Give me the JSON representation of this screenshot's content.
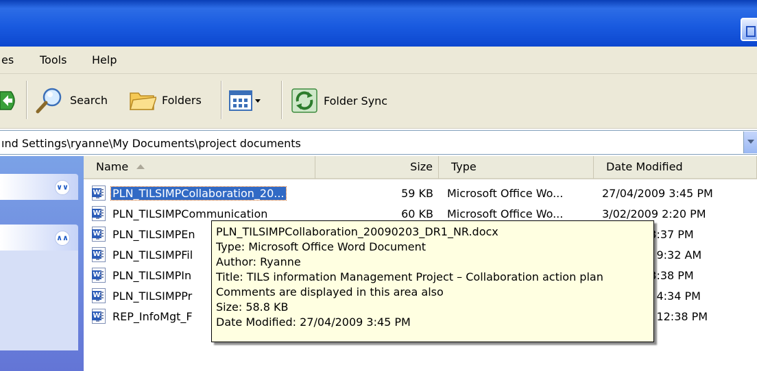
{
  "menu": {
    "items": [
      "es",
      "Tools",
      "Help"
    ]
  },
  "toolbar": {
    "search_label": "Search",
    "folders_label": "Folders",
    "folder_sync_label": "Folder Sync"
  },
  "address": {
    "path": "ınd Settings\\ryanne\\My Documents\\project documents"
  },
  "columns": {
    "name": "Name",
    "size": "Size",
    "type": "Type",
    "date": "Date Modified"
  },
  "files": [
    {
      "name": "PLN_TILSIMPCollaboration_20...",
      "size": "59 KB",
      "type": "Microsoft Office Wo...",
      "date": "27/04/2009 3:45 PM",
      "selected": true
    },
    {
      "name": "PLN_TILSIMPCommunication",
      "size": "60 KB",
      "type": "Microsoft Office Wo...",
      "date": "3/02/2009 2:20 PM"
    },
    {
      "name": "PLN_TILSIMPEn",
      "size": "",
      "type": "",
      "date": "9 3:37 PM"
    },
    {
      "name": "PLN_TILSIMPFil",
      "size": "",
      "type": "",
      "date": "09 9:32 AM"
    },
    {
      "name": "PLN_TILSIMPIn",
      "size": "",
      "type": "",
      "date": "9 3:38 PM"
    },
    {
      "name": "PLN_TILSIMPPr",
      "size": "",
      "type": "",
      "date": "09 4:34 PM"
    },
    {
      "name": "REP_InfoMgt_F",
      "size": "",
      "type": "",
      "date": "09 12:38 PM"
    }
  ],
  "tooltip": {
    "filename": "PLN_TILSIMPCollaboration_20090203_DR1_NR.docx",
    "type": "Type: Microsoft Office Word Document",
    "author": "Author: Ryanne",
    "title": "Title: TILS information Management Project – Collaboration action plan",
    "comments": "Comments are displayed in this area also",
    "size": "Size: 58.8 KB",
    "date": "Date Modified: 27/04/2009 3:45 PM"
  },
  "colors": {
    "titlebar": "#1a5be0",
    "selection": "#316ac5",
    "tooltip_bg": "#ffffe1",
    "taskpane": "#6f8ddb"
  }
}
